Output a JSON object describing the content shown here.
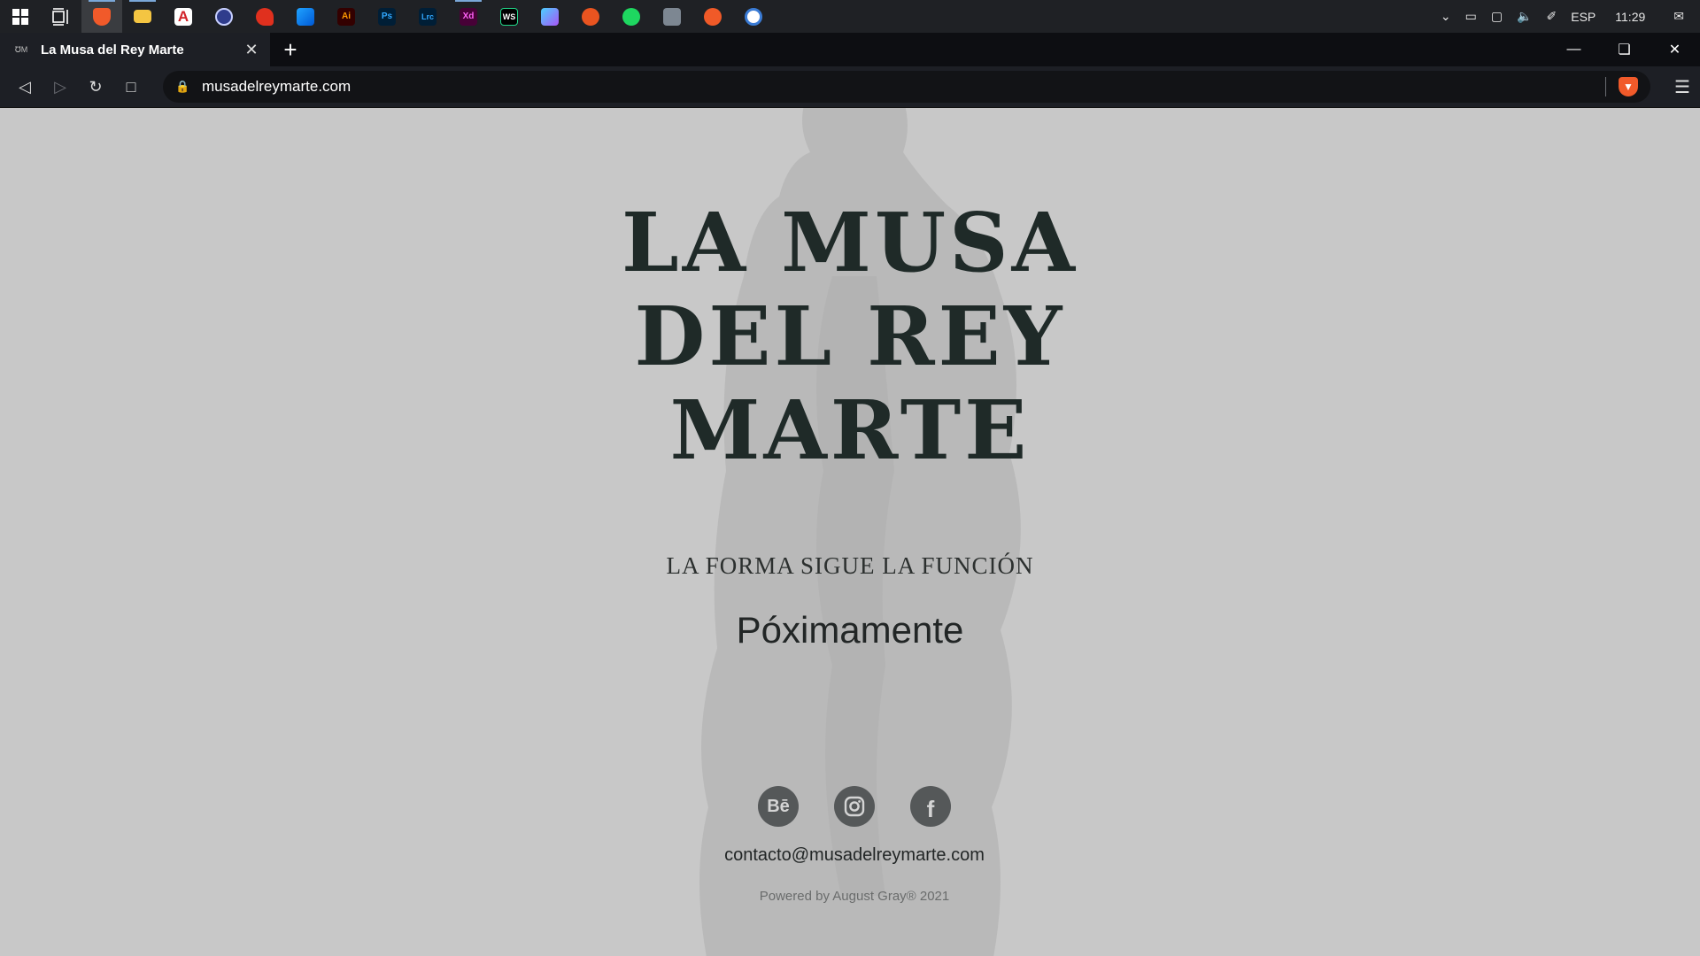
{
  "taskbar": {
    "apps": [
      {
        "name": "start",
        "label": ""
      },
      {
        "name": "task-view",
        "label": ""
      },
      {
        "name": "brave",
        "label": ""
      },
      {
        "name": "file-explorer",
        "label": ""
      },
      {
        "name": "acrobat",
        "label": "A"
      },
      {
        "name": "cinema4d",
        "label": ""
      },
      {
        "name": "app-red",
        "label": ""
      },
      {
        "name": "app-blue",
        "label": ""
      },
      {
        "name": "illustrator",
        "label": "Ai"
      },
      {
        "name": "photoshop",
        "label": "Ps"
      },
      {
        "name": "lightroom",
        "label": "Lrc"
      },
      {
        "name": "xd",
        "label": "Xd"
      },
      {
        "name": "webstorm",
        "label": "WS"
      },
      {
        "name": "app-gradient",
        "label": ""
      },
      {
        "name": "ubuntu",
        "label": ""
      },
      {
        "name": "spotify",
        "label": ""
      },
      {
        "name": "app-tool",
        "label": ""
      },
      {
        "name": "app-orange",
        "label": ""
      },
      {
        "name": "app-blue-circle",
        "label": ""
      }
    ],
    "language": "ESP",
    "time": "11:29"
  },
  "browser": {
    "tab_title": "La Musa del Rey Marte",
    "favicon_text": "℧M",
    "new_tab": "+",
    "url": "musadelreymarte.com"
  },
  "page": {
    "logo_lines": [
      "LA MUSA",
      "DEL REY",
      "MARTE"
    ],
    "tagline": "LA FORMA SIGUE LA FUNCIÓN",
    "coming_soon": "Póximamente",
    "socials": [
      {
        "name": "behance",
        "label": "Bē"
      },
      {
        "name": "instagram",
        "label": ""
      },
      {
        "name": "facebook",
        "label": "f"
      }
    ],
    "contact_email": "contacto@musadelreymarte.com",
    "powered_by": "Powered by August Gray® 2021"
  },
  "colors": {
    "page_bg": "#c8c8c8",
    "logo_text": "#1f2a28",
    "social_bg": "#555859",
    "brave_orange": "#f15a2a"
  }
}
